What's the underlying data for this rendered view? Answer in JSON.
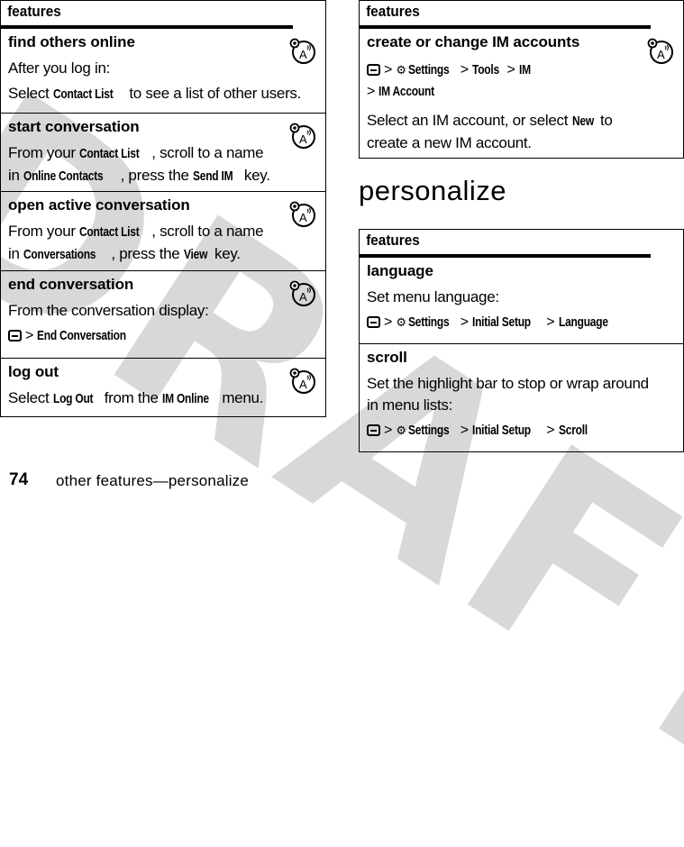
{
  "watermark": "DRAFT",
  "left_table": {
    "header": "features",
    "rows": [
      {
        "title": "find others online",
        "lines": [
          {
            "text": "After you log in:"
          },
          {
            "pre": "Select ",
            "kw": "Contact List",
            "post": " to see a list of other users."
          }
        ]
      },
      {
        "title": "start conversation",
        "line1": {
          "pre": "From your ",
          "kw": "Contact List",
          "post": ", scroll to a name"
        },
        "line2": {
          "pre": "in ",
          "kw": "Online Contacts",
          "mid": ", press the ",
          "kw2": "Send IM",
          "post": " key."
        }
      },
      {
        "title": "open active conversation",
        "line1": {
          "pre": "From your ",
          "kw": "Contact List",
          "post": ", scroll to a name"
        },
        "line2": {
          "pre": "in ",
          "kw": "Conversations",
          "mid": ", press the ",
          "kw2": "View",
          "post": " key."
        }
      },
      {
        "title": "end conversation",
        "text": "From the conversation display:",
        "path": {
          "sep": ">",
          "item": "End Conversation"
        }
      },
      {
        "title": "log out",
        "line": {
          "pre": "Select ",
          "kw": "Log Out",
          "mid": " from the ",
          "kw2": "IM Online",
          "post": " menu."
        }
      }
    ]
  },
  "right_table_top": {
    "header": "features",
    "row": {
      "title": "create or change IM accounts",
      "path": [
        "Settings",
        "Tools",
        "IM",
        "IM Account"
      ],
      "sep": ">",
      "desc": {
        "pre": "Select an IM account, or select ",
        "kw": "New",
        "post": " to",
        "line2": "create a new IM account."
      }
    }
  },
  "section_heading": "personalize",
  "right_table_bottom": {
    "header": "features",
    "rows": [
      {
        "title": "language",
        "text": "Set menu language:",
        "path": [
          "Settings",
          "Initial Setup",
          "Language"
        ]
      },
      {
        "title": "scroll",
        "text1": "Set the highlight bar to stop or wrap around",
        "text2": "in menu lists:",
        "path": [
          "Settings",
          "Initial Setup",
          "Scroll"
        ]
      }
    ],
    "sep": ">"
  },
  "icons": {
    "menu_key": "menu-key-icon",
    "settings": "settings-icon",
    "im": "im-feature-icon",
    "settings_glyph": "⚙"
  },
  "footer": {
    "page_number": "74",
    "section": "other features—personalize"
  }
}
